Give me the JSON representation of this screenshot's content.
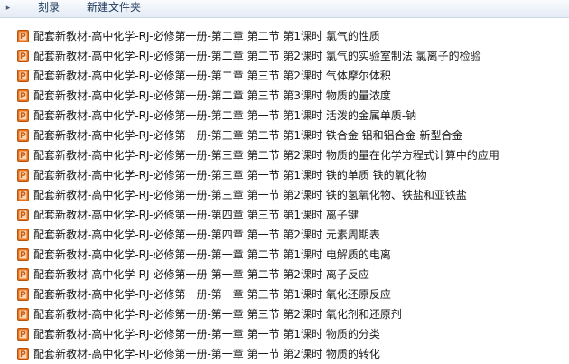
{
  "toolbar": {
    "burn_label": "刻录",
    "new_folder_label": "新建文件夹"
  },
  "files": [
    {
      "name": "配套新教材-高中化学-RJ-必修第一册-第二章 第二节 第1课时 氯气的性质",
      "icon": "ppt-file-icon"
    },
    {
      "name": "配套新教材-高中化学-RJ-必修第一册-第二章 第二节 第2课时 氯气的实验室制法 氯离子的检验",
      "icon": "ppt-file-icon"
    },
    {
      "name": "配套新教材-高中化学-RJ-必修第一册-第二章 第三节 第2课时 气体摩尔体积",
      "icon": "ppt-file-icon"
    },
    {
      "name": "配套新教材-高中化学-RJ-必修第一册-第二章 第三节 第3课时 物质的量浓度",
      "icon": "ppt-file-icon"
    },
    {
      "name": "配套新教材-高中化学-RJ-必修第一册-第二章 第一节 第1课时 活泼的金属单质-钠",
      "icon": "ppt-file-icon"
    },
    {
      "name": "配套新教材-高中化学-RJ-必修第一册-第三章 第二节 第1课时 铁合金 铝和铝合金 新型合金",
      "icon": "ppt-file-icon"
    },
    {
      "name": "配套新教材-高中化学-RJ-必修第一册-第三章 第二节 第2课时 物质的量在化学方程式计算中的应用",
      "icon": "ppt-file-icon"
    },
    {
      "name": "配套新教材-高中化学-RJ-必修第一册-第三章 第一节 第1课时 铁的单质 铁的氧化物",
      "icon": "ppt-file-icon"
    },
    {
      "name": "配套新教材-高中化学-RJ-必修第一册-第三章 第一节 第2课时 铁的氢氧化物、铁盐和亚铁盐",
      "icon": "ppt-file-icon"
    },
    {
      "name": "配套新教材-高中化学-RJ-必修第一册-第四章 第三节 第1课时 离子键",
      "icon": "ppt-file-icon"
    },
    {
      "name": "配套新教材-高中化学-RJ-必修第一册-第四章 第一节 第2课时 元素周期表",
      "icon": "ppt-file-icon"
    },
    {
      "name": "配套新教材-高中化学-RJ-必修第一册-第一章 第二节 第1课时 电解质的电离",
      "icon": "ppt-file-icon"
    },
    {
      "name": "配套新教材-高中化学-RJ-必修第一册-第一章 第二节 第2课时 离子反应",
      "icon": "ppt-file-icon"
    },
    {
      "name": "配套新教材-高中化学-RJ-必修第一册-第一章 第三节 第1课时 氧化还原反应",
      "icon": "ppt-file-icon"
    },
    {
      "name": "配套新教材-高中化学-RJ-必修第一册-第一章 第三节 第2课时 氧化剂和还原剂",
      "icon": "ppt-file-icon"
    },
    {
      "name": "配套新教材-高中化学-RJ-必修第一册-第一章 第一节 第1课时 物质的分类",
      "icon": "ppt-file-icon"
    },
    {
      "name": "配套新教材-高中化学-RJ-必修第一册-第一章 第一节 第2课时 物质的转化",
      "icon": "ppt-file-icon"
    }
  ],
  "colors": {
    "icon_orange": "#e8731c",
    "icon_light": "#fbd9b8"
  }
}
